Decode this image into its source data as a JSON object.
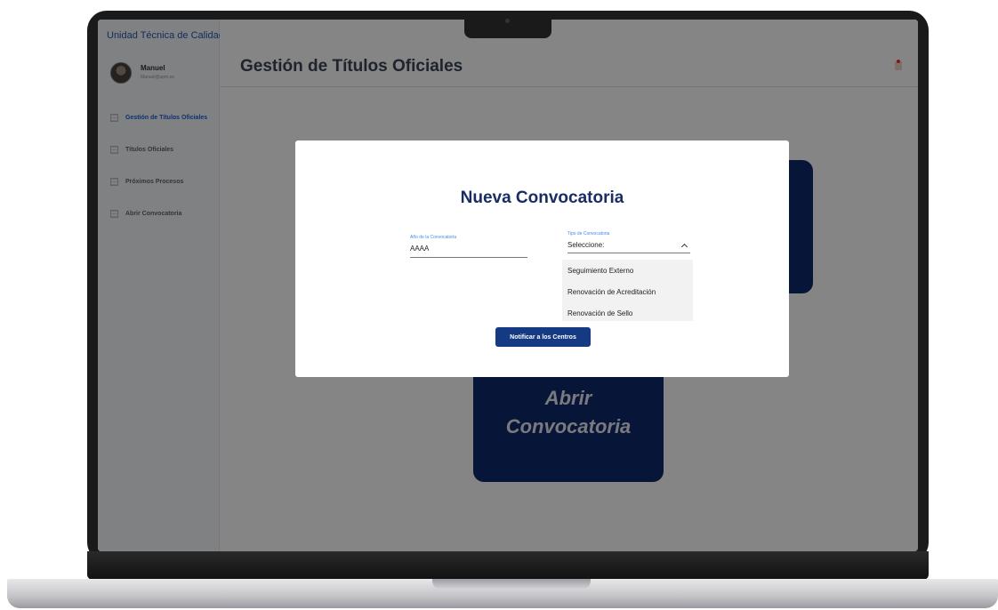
{
  "app": {
    "brand": "Unidad Técnica de Calidad",
    "user": {
      "name": "Manuel",
      "email": "Manuel@upm.es"
    }
  },
  "sidebar": {
    "items": [
      {
        "label": "Gestión de Títulos Oficiales",
        "active": true
      },
      {
        "label": "Títulos Oficiales"
      },
      {
        "label": "Próximos Procesos"
      },
      {
        "label": "Abrir Convocatoria"
      }
    ]
  },
  "header": {
    "title": "Gestión de Títulos Oficiales"
  },
  "background_card": {
    "line1": "Abrir",
    "line2": "Convocatoria"
  },
  "modal": {
    "title": "Nueva Convocatoria",
    "year_field": {
      "label": "Año de la Convocatoria",
      "value": "AAAA"
    },
    "type_field": {
      "label": "Tipo de Convocatoria",
      "selected": "Seleccione:",
      "options": [
        "Seguimiento Externo",
        "Renovación de Acreditación",
        "Renovación de Sello"
      ]
    },
    "submit_label": "Notificar a los Centros"
  },
  "colors": {
    "primary": "#153a84",
    "card": "#0d2a6b",
    "brand": "#2457b5",
    "accent": "#3d8de8"
  },
  "icons": [
    "menu-page-icon",
    "notification-icon",
    "chevron-up-icon"
  ]
}
